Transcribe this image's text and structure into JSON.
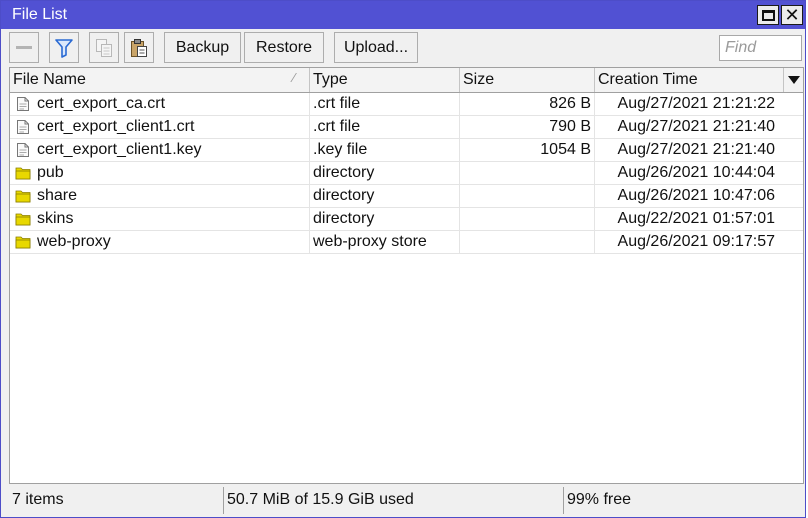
{
  "window": {
    "title": "File List"
  },
  "toolbar": {
    "backup_label": "Backup",
    "restore_label": "Restore",
    "upload_label": "Upload...",
    "find_placeholder": "Find",
    "icons": [
      "minus-icon",
      "filter-icon",
      "copy-icon",
      "paste-icon"
    ]
  },
  "table": {
    "columns": [
      "File Name",
      "Type",
      "Size",
      "Creation Time"
    ],
    "rows": [
      {
        "name": "cert_export_ca.crt",
        "type": ".crt file",
        "size": "826 B",
        "created": "Aug/27/2021 21:21:22",
        "icon": "file-icon"
      },
      {
        "name": "cert_export_client1.crt",
        "type": ".crt file",
        "size": "790 B",
        "created": "Aug/27/2021 21:21:40",
        "icon": "file-icon"
      },
      {
        "name": "cert_export_client1.key",
        "type": ".key file",
        "size": "1054 B",
        "created": "Aug/27/2021 21:21:40",
        "icon": "file-icon"
      },
      {
        "name": "pub",
        "type": "directory",
        "size": "",
        "created": "Aug/26/2021 10:44:04",
        "icon": "folder-icon"
      },
      {
        "name": "share",
        "type": "directory",
        "size": "",
        "created": "Aug/26/2021 10:47:06",
        "icon": "folder-icon"
      },
      {
        "name": "skins",
        "type": "directory",
        "size": "",
        "created": "Aug/22/2021 01:57:01",
        "icon": "folder-icon"
      },
      {
        "name": "web-proxy",
        "type": "web-proxy store",
        "size": "",
        "created": "Aug/26/2021 09:17:57",
        "icon": "folder-icon"
      }
    ]
  },
  "status": {
    "items": "7 items",
    "usage": "50.7 MiB of 15.9 GiB used",
    "free": "99% free"
  },
  "colors": {
    "titlebar": "#5151d3",
    "folder": "#e8d800",
    "filter_icon": "#2a6ad3"
  }
}
